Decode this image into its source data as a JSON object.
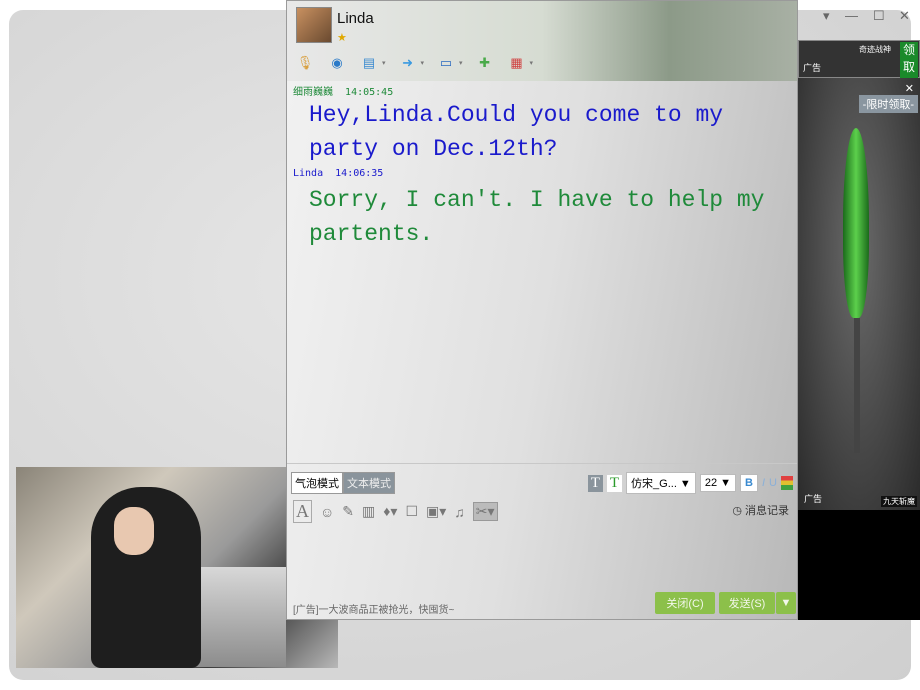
{
  "window": {
    "contact_name": "Linda",
    "controls": [
      "▾",
      "—",
      "☐",
      "✕"
    ]
  },
  "toolbar": [
    {
      "icon": "microphone-icon",
      "glyph": "🎙"
    },
    {
      "icon": "webcam-icon",
      "glyph": "◉"
    },
    {
      "icon": "screen-share-icon",
      "glyph": "▤"
    },
    {
      "icon": "file-transfer-icon",
      "glyph": "➜"
    },
    {
      "icon": "remote-desktop-icon",
      "glyph": "▭"
    },
    {
      "icon": "add-chat-icon",
      "glyph": "✚"
    },
    {
      "icon": "apps-icon",
      "glyph": "▦"
    }
  ],
  "messages": [
    {
      "sender": "细雨巍巍",
      "time": "14:05:45",
      "text": "Hey,Linda.Could you come to my party on Dec.12th?",
      "sender_color": "#1f8a3a",
      "text_color": "#1a1acc"
    },
    {
      "sender": "Linda",
      "time": "14:06:35",
      "text": "Sorry, I can't. I have to help my partents.",
      "sender_color": "#1a1acc",
      "text_color": "#1f8a3a"
    }
  ],
  "input": {
    "mode_bubble": "气泡模式",
    "mode_text": "文本模式",
    "font": "仿宋_G...",
    "size": "22",
    "bold": "B",
    "italic": "I",
    "underline": "U",
    "history": "消息记录",
    "ad_text": "[广告]一大波商品正被抢光，快囤货~",
    "close_button": "关闭(C)",
    "send_button": "发送(S)"
  },
  "ad": {
    "banner_title": "奇迹战神",
    "banner_label": "广告",
    "claim": "领取",
    "promo": "-限时领取-",
    "label": "广告",
    "game": "九天斩魔"
  }
}
